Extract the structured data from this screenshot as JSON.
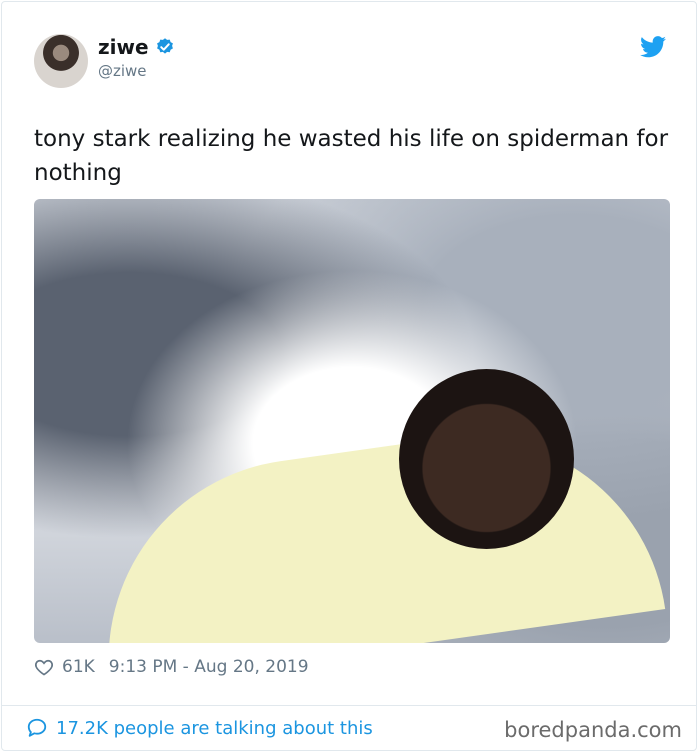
{
  "tweet": {
    "author": {
      "name": "ziwe",
      "handle": "@ziwe",
      "verified": true
    },
    "text": "tony stark realizing he wasted his life on spiderman for nothing",
    "likes": "61K",
    "timestamp": "9:13 PM - Aug 20, 2019",
    "talking": "17.2K people are talking about this"
  },
  "watermark": "boredpanda.com",
  "icons": {
    "avatar": "avatar",
    "verified": "verified-badge-icon",
    "brand": "twitter-bird-icon",
    "like": "heart-icon",
    "talking": "speech-bubble-icon"
  },
  "colors": {
    "accent": "#1b95e0",
    "muted": "#657786",
    "text": "#14171a"
  }
}
